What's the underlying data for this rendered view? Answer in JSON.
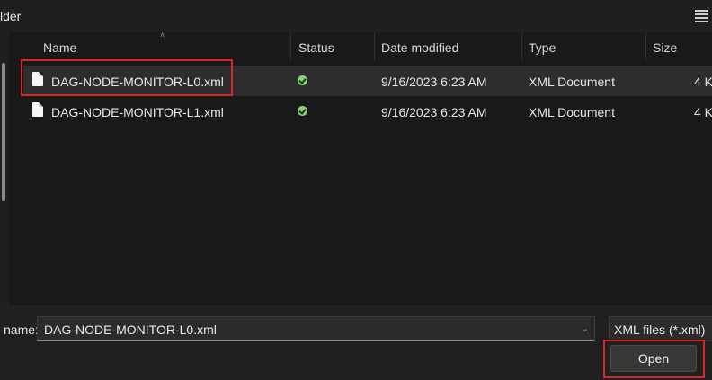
{
  "breadcrumb": "lder",
  "columns": {
    "name": "Name",
    "status": "Status",
    "date_modified": "Date modified",
    "type": "Type",
    "size": "Size"
  },
  "files": [
    {
      "name": "DAG-NODE-MONITOR-L0.xml",
      "status": "synced-check",
      "date": "9/16/2023 6:23 AM",
      "type": "XML Document",
      "size": "4 K",
      "selected": true
    },
    {
      "name": "DAG-NODE-MONITOR-L1.xml",
      "status": "synced-check",
      "date": "9/16/2023 6:23 AM",
      "type": "XML Document",
      "size": "4 K",
      "selected": false
    }
  ],
  "footer": {
    "filename_label": "name:",
    "filename_value": "DAG-NODE-MONITOR-L0.xml",
    "filetype_value": "XML files (*.xml)",
    "open_label": "Open"
  },
  "colors": {
    "highlight": "#d8262b",
    "status_ok": "#8bd17c",
    "background": "#191919"
  }
}
